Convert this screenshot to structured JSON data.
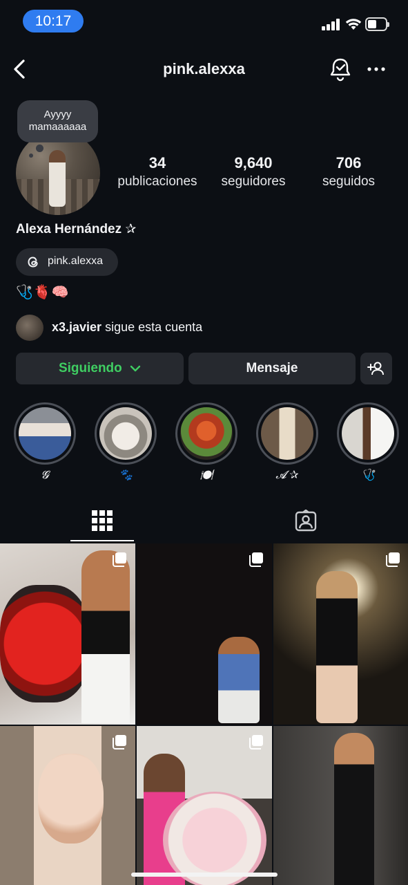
{
  "status": {
    "time": "10:17"
  },
  "nav": {
    "username": "pink.alexxa"
  },
  "note": {
    "text": "Ayyyy mamaaaaaa"
  },
  "stats": [
    {
      "value": "34",
      "label": "publicaciones"
    },
    {
      "value": "9,640",
      "label": "seguidores"
    },
    {
      "value": "706",
      "label": "seguidos"
    }
  ],
  "profile": {
    "name": "Alexa Hernández ✰",
    "threads_handle": "pink.alexxa",
    "bio": "🩺🫀🧠"
  },
  "followed_by": {
    "user": "x3.javier",
    "text": "sigue esta cuenta"
  },
  "actions": {
    "following_label": "Siguiendo",
    "message_label": "Mensaje"
  },
  "highlights": [
    {
      "label": "𝓖",
      "icon": "highlight-photo"
    },
    {
      "label": "🐾",
      "icon": "highlight-photo"
    },
    {
      "label": "🍽️",
      "icon": "highlight-photo"
    },
    {
      "label": "𝓐 ✰",
      "icon": "highlight-photo"
    },
    {
      "label": "🩺",
      "icon": "highlight-photo"
    }
  ],
  "tabs": [
    {
      "name": "posts",
      "icon": "grid-icon",
      "active": true
    },
    {
      "name": "tagged",
      "icon": "tagged-icon",
      "active": false
    }
  ],
  "posts": [
    {
      "multi": true
    },
    {
      "multi": true
    },
    {
      "multi": true
    },
    {
      "multi": true
    },
    {
      "multi": true
    },
    {
      "multi": false
    }
  ],
  "colors": {
    "accent_green": "#3fce62",
    "time_pill": "#2f7cf0",
    "background": "#0c0f14",
    "button": "#26292f"
  }
}
